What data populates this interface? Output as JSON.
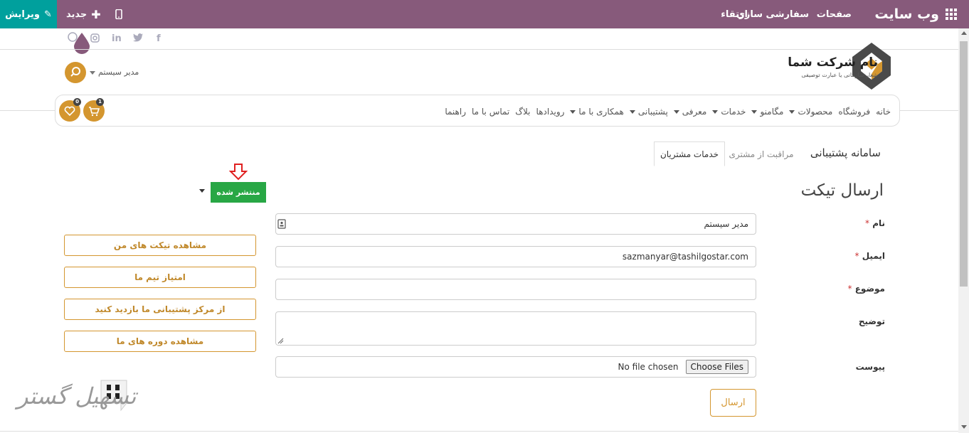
{
  "topbar": {
    "brand": "وب سایت",
    "menu": [
      "صفحات",
      "سفارشی سازی",
      "ارتقاء"
    ],
    "new_label": "جدید",
    "edit_label": "ویرایش",
    "bg_color": "#875a7b",
    "edit_color": "#00a09d"
  },
  "header": {
    "company_name": "نام شرکت شما",
    "company_tagline": "شعار سازمانی یا عبارت توصیفی",
    "user_name": "مدیر سیستم",
    "social_icons": [
      "facebook-icon",
      "twitter-icon",
      "linkedin-icon",
      "instagram-icon",
      "pinterest-icon"
    ],
    "cart_count": "1",
    "wishlist_count": "0"
  },
  "nav": {
    "items": [
      {
        "label": "خانه"
      },
      {
        "label": "فروشگاه"
      },
      {
        "label": "محصولات",
        "dropdown": true
      },
      {
        "label": "مگامنو",
        "dropdown": true
      },
      {
        "label": "خدمات",
        "dropdown": true
      },
      {
        "label": "معرفی",
        "dropdown": true
      },
      {
        "label": "پشتیبانی",
        "dropdown": true
      },
      {
        "label": "همکاری با ما",
        "dropdown": true
      },
      {
        "label": "رویدادها"
      },
      {
        "label": "بلاگ"
      },
      {
        "label": "تماس با ما"
      },
      {
        "label": "راهنما"
      }
    ]
  },
  "tabs": {
    "section_title": "سامانه پشتیبانی",
    "items": [
      "مراقبت از مشتری",
      "خدمات مشتریان"
    ]
  },
  "page": {
    "title": "ارسال تیکت",
    "publish_label": "منتشر شده"
  },
  "form": {
    "name_label": "نام",
    "name_value": "مدیر سیستم",
    "email_label": "ایمیل",
    "email_value": "sazmanyar@tashilgostar.com",
    "subject_label": "موضوع",
    "description_label": "توضیح",
    "attachment_label": "پیوست",
    "choose_files": "Choose Files",
    "no_file": "No file chosen",
    "required_mark": "*",
    "submit_label": "ارسال"
  },
  "side_buttons": [
    "مشاهده تیکت های من",
    "امتیاز تیم ما",
    "از مرکز پشتیبانی ما بازدید کنید",
    "مشاهده دوره های ما"
  ],
  "watermark": "تسهیل گستر",
  "accent_color": "#d4962f"
}
